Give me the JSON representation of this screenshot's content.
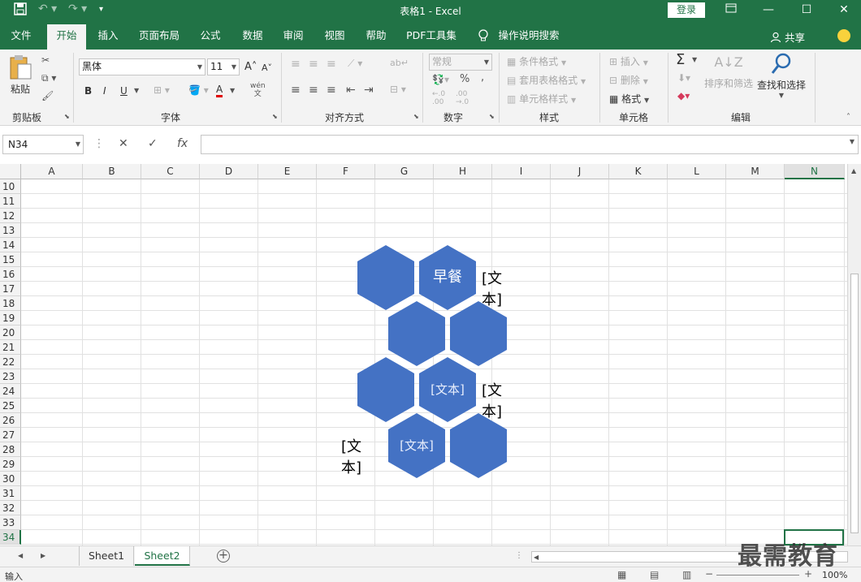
{
  "titlebar": {
    "doc_title": "表格1  -  Excel",
    "login": "登录",
    "icons": [
      "save-icon",
      "undo-icon",
      "redo-icon",
      "customize-qa-icon",
      "ribbon-display-icon",
      "minimize-icon",
      "maximize-icon",
      "close-icon"
    ]
  },
  "menu": {
    "tabs": [
      "文件",
      "开始",
      "插入",
      "页面布局",
      "公式",
      "数据",
      "审阅",
      "视图",
      "帮助",
      "PDF工具集"
    ],
    "active": "开始",
    "search": "操作说明搜索",
    "share": "共享"
  },
  "ribbon": {
    "clipboard": {
      "paste": "粘贴",
      "label": "剪贴板"
    },
    "font": {
      "name": "黑体",
      "size": "11",
      "bold": "B",
      "italic": "I",
      "underline": "U",
      "grow": "A",
      "shrink": "A",
      "font_color": "A",
      "phonetic": "wén\n文",
      "label": "字体"
    },
    "alignment": {
      "label": "对齐方式"
    },
    "number": {
      "format": "常规",
      "percent": "%",
      "comma": ",",
      "label": "数字"
    },
    "styles": {
      "conditional": "条件格式",
      "table_format": "套用表格格式",
      "cell_styles": "单元格样式",
      "label": "样式"
    },
    "cells": {
      "insert": "插入",
      "delete": "删除",
      "format": "格式",
      "label": "单元格"
    },
    "editing": {
      "sort_filter": "排序和筛选",
      "find_select": "查找和选择",
      "label": "编辑"
    }
  },
  "formula_bar": {
    "name_box": "N34",
    "cancel": "✕",
    "enter": "✓",
    "fx": "fx",
    "value": ""
  },
  "sheet": {
    "columns": [
      "A",
      "B",
      "C",
      "D",
      "E",
      "F",
      "G",
      "H",
      "I",
      "J",
      "K",
      "L",
      "M",
      "N"
    ],
    "rows": [
      "10",
      "11",
      "12",
      "13",
      "14",
      "15",
      "16",
      "17",
      "18",
      "19",
      "20",
      "21",
      "22",
      "23",
      "24",
      "25",
      "26",
      "27",
      "28",
      "29",
      "30",
      "31",
      "32",
      "33",
      "34"
    ],
    "selected_column": "N",
    "selected_row": "34"
  },
  "smartart": {
    "hex_top_right": "早餐",
    "label_top": "[文本]",
    "hex_mid_right": "[文本]",
    "label_mid": "[文本]",
    "hex_bottom_left": "[文本]",
    "label_bottom": "[文本]",
    "fill_color": "#4472c4"
  },
  "sheet_tabs": [
    "Sheet1",
    "Sheet2"
  ],
  "active_sheet": "Sheet2",
  "status": {
    "mode": "输入",
    "zoom": "100%"
  },
  "watermark": "最需教育"
}
